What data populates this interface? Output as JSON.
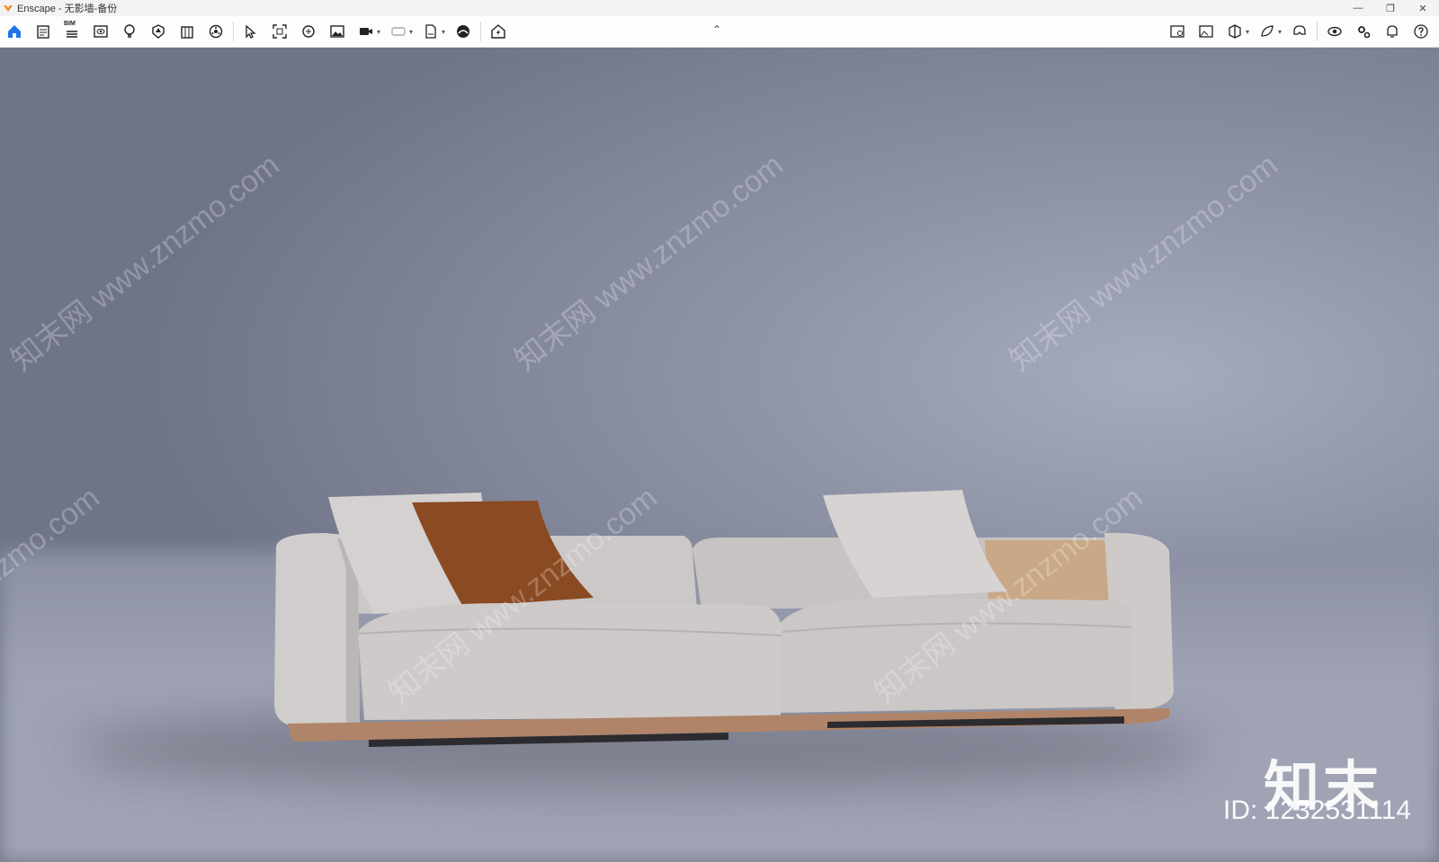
{
  "window": {
    "title": "Enscape - 无影墙-备份",
    "minimize": "—",
    "restore": "❐",
    "close": "✕"
  },
  "toolbar": {
    "left_icons": [
      "home-icon",
      "project-icon",
      "bim-icon",
      "views-icon",
      "light-icon",
      "asset-library-icon",
      "building-icon",
      "sun-settings-icon",
      "select-icon",
      "screenshot-icon",
      "panorama-icon",
      "image-icon",
      "video-editor-icon",
      "vr-icon",
      "export-exe-icon",
      "collaborate-icon",
      "live-update-icon"
    ],
    "bim_label": "BIM",
    "collapse_glyph": "⌃",
    "right_icons": [
      "hide-ui-icon",
      "image-settings-icon",
      "section-icon",
      "material-editor-icon",
      "vr-headset-icon",
      "visual-settings-icon",
      "settings-icon",
      "notifications-icon",
      "help-icon"
    ],
    "accent": "#1e73e8"
  },
  "viewport": {
    "watermark": "知末网 www.znzmo.com",
    "brand": "知末",
    "id_label": "ID: 1232531114",
    "colors": {
      "sofa": "#cfcccb",
      "sofa_shade": "#b5b2b1",
      "pillow_orange": "#8a4a22",
      "pillow_tan": "#c8a886",
      "base_wood": "#b08468"
    }
  }
}
